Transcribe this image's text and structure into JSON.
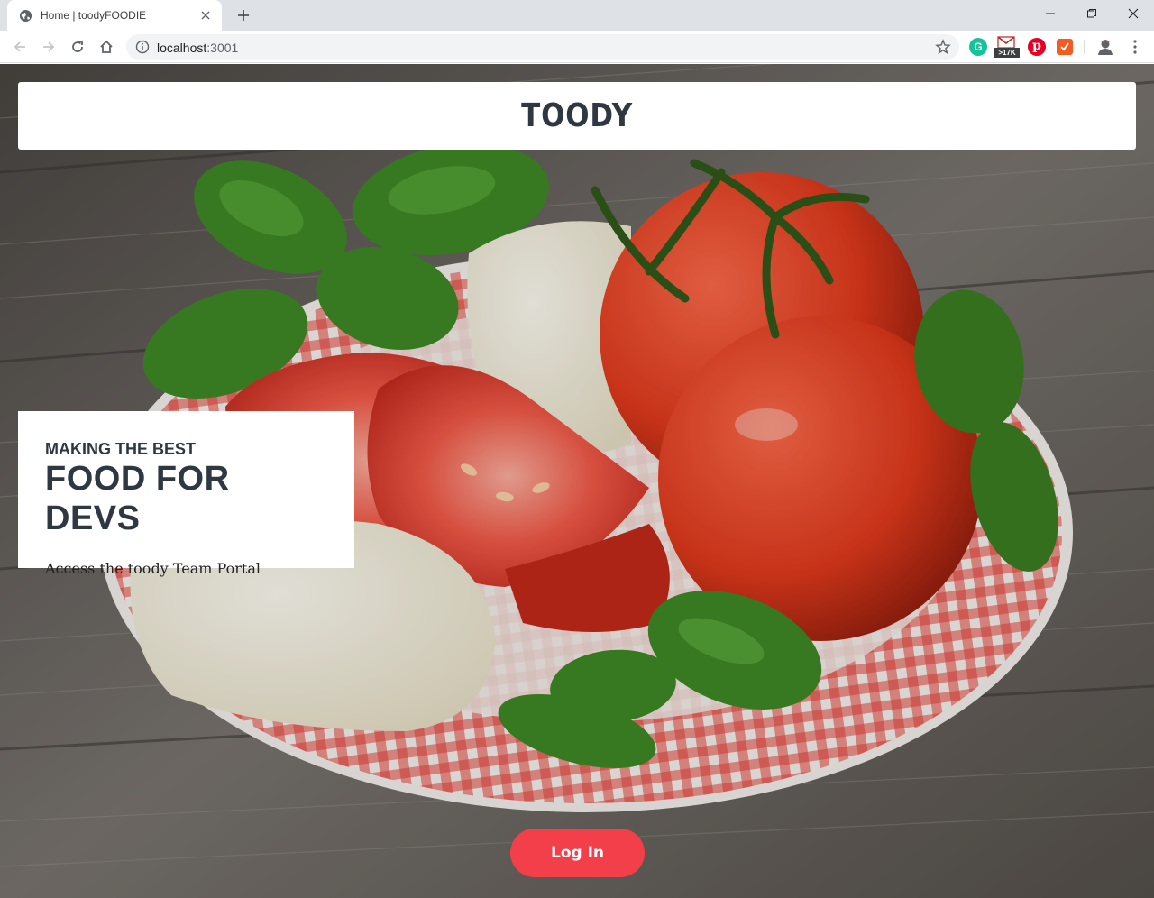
{
  "browser": {
    "tab_title": "Home | toodyFOODIE",
    "url_host": "localhost",
    "url_port": ":3001",
    "extensions": [
      {
        "name": "grammarly-icon",
        "color": "#15c39a",
        "label": "G"
      },
      {
        "name": "gmail-icon",
        "badge": ">17K"
      },
      {
        "name": "pinterest-icon",
        "color": "#e60023",
        "label": "p"
      },
      {
        "name": "todoist-icon",
        "color": "#f45b22"
      },
      {
        "name": "profile-avatar-icon"
      }
    ]
  },
  "page": {
    "brand": "TOODY",
    "hero": {
      "kicker": "MAKING THE BEST",
      "title": "FOOD FOR DEVS",
      "subtitle": "Access the toody Team Portal"
    },
    "login_label": "Log In"
  },
  "colors": {
    "accent": "#f23f49",
    "heading": "#2f3842"
  }
}
